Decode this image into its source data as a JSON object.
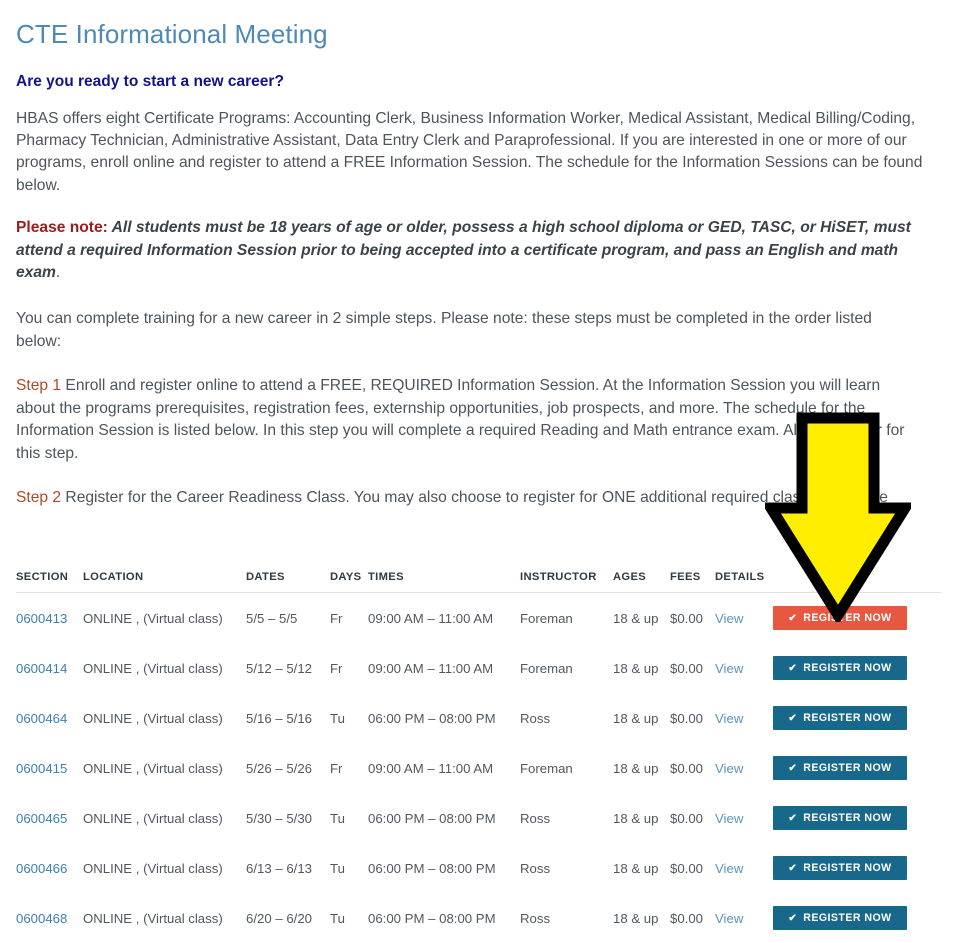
{
  "page": {
    "title": "CTE Informational Meeting",
    "subtitle": "Are you ready to start a new career?",
    "intro": " HBAS offers eight Certificate Programs: Accounting Clerk, Business Information Worker, Medical Assistant, Medical Billing/Coding, Pharmacy Technician, Administrative Assistant, Data Entry Clerk and Paraprofessional. If you are interested in one or more of our programs, enroll online and register to attend a FREE Information Session. The schedule for the Information Sessions can be found below.",
    "note_label": "Please note:",
    "note_body": " All students must be 18 years of age or older, possess a high school diploma or GED, TASC, or HiSET, must attend a required Information Session prior to being accepted into a certificate program, and pass an English and math exam",
    "note_tail": ".",
    "steps_intro": "You can complete training for a new career in 2 simple steps. Please note: these steps must be completed in the order listed below:",
    "step1_label": "Step 1",
    "step1_body": " Enroll and register online to attend a FREE, REQUIRED Information Session. At the Information Session you will learn about the programs prerequisites, registration fees, externship opportunities, job prospects, and more. The schedule for the Information Session is listed below. In this step you will complete a required Reading and Math entrance exam. Allow 1.5 hour for this step.",
    "step2_label": "Step 2",
    "step2_body": " Register for the Career Readiness Class. You may also choose to register for ONE additional required class at this time"
  },
  "colors": {
    "title_blue": "#4e8ab5",
    "subtitle_navy": "#12128e",
    "note_red": "#9e1b1b",
    "step_red": "#b04a26",
    "button_blue": "#17688a",
    "button_red": "#e8573f",
    "link_blue": "#3c7fb1",
    "arrow_yellow": "#ffee00",
    "arrow_outline": "#000000"
  },
  "table": {
    "columns": [
      "SECTION",
      "LOCATION",
      "DATES",
      "DAYS",
      "TIMES",
      "INSTRUCTOR",
      "AGES",
      "FEES",
      "DETAILS",
      ""
    ],
    "details_link_label": "View",
    "register_label": "REGISTER NOW",
    "check_glyph": "✔",
    "rows": [
      {
        "section": "0600413",
        "location": "ONLINE , (Virtual class)",
        "dates": "5/5 – 5/5",
        "days": "Fr",
        "times": "09:00 AM – 11:00 AM",
        "instructor": "Foreman",
        "ages": "18 & up",
        "fees": "$0.00",
        "details": "View",
        "register": "REGISTER NOW",
        "highlighted": true
      },
      {
        "section": "0600414",
        "location": "ONLINE , (Virtual class)",
        "dates": "5/12 – 5/12",
        "days": "Fr",
        "times": "09:00 AM – 11:00 AM",
        "instructor": "Foreman",
        "ages": "18 & up",
        "fees": "$0.00",
        "details": "View",
        "register": "REGISTER NOW",
        "highlighted": false
      },
      {
        "section": "0600464",
        "location": "ONLINE , (Virtual class)",
        "dates": "5/16 – 5/16",
        "days": "Tu",
        "times": "06:00 PM – 08:00 PM",
        "instructor": "Ross",
        "ages": "18 & up",
        "fees": "$0.00",
        "details": "View",
        "register": "REGISTER NOW",
        "highlighted": false
      },
      {
        "section": "0600415",
        "location": "ONLINE , (Virtual class)",
        "dates": "5/26 – 5/26",
        "days": "Fr",
        "times": "09:00 AM – 11:00 AM",
        "instructor": "Foreman",
        "ages": "18 & up",
        "fees": "$0.00",
        "details": "View",
        "register": "REGISTER NOW",
        "highlighted": false
      },
      {
        "section": "0600465",
        "location": "ONLINE , (Virtual class)",
        "dates": "5/30 – 5/30",
        "days": "Tu",
        "times": "06:00 PM – 08:00 PM",
        "instructor": "Ross",
        "ages": "18 & up",
        "fees": "$0.00",
        "details": "View",
        "register": "REGISTER NOW",
        "highlighted": false
      },
      {
        "section": "0600466",
        "location": "ONLINE , (Virtual class)",
        "dates": "6/13 – 6/13",
        "days": "Tu",
        "times": "06:00 PM – 08:00 PM",
        "instructor": "Ross",
        "ages": "18 & up",
        "fees": "$0.00",
        "details": "View",
        "register": "REGISTER NOW",
        "highlighted": false
      },
      {
        "section": "0600468",
        "location": "ONLINE , (Virtual class)",
        "dates": "6/20 – 6/20",
        "days": "Tu",
        "times": "06:00 PM – 08:00 PM",
        "instructor": "Ross",
        "ages": "18 & up",
        "fees": "$0.00",
        "details": "View",
        "register": "REGISTER NOW",
        "highlighted": false
      }
    ]
  },
  "annotation": {
    "arrow": "down-arrow-annotation"
  }
}
